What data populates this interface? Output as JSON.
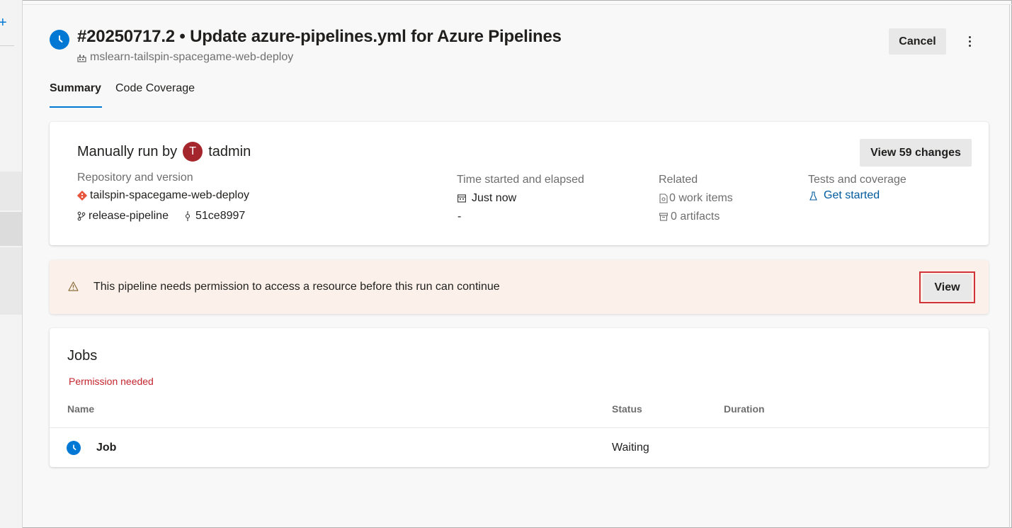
{
  "header": {
    "run_title": "#20250717.2 • Update azure-pipelines.yml for Azure Pipelines",
    "repo_name": "mslearn-tailspin-spacegame-web-deploy",
    "cancel_label": "Cancel",
    "more_icon": "more-vertical-icon",
    "status_icon": "clock-icon"
  },
  "tabs": [
    {
      "label": "Summary",
      "active": true
    },
    {
      "label": "Code Coverage",
      "active": false
    }
  ],
  "summary": {
    "manual_prefix": "Manually run by",
    "user_initial": "T",
    "user_name": "tadmin",
    "view_changes_label": "View 59 changes",
    "repo_label": "Repository and version",
    "repo_value": "tailspin-spacegame-web-deploy",
    "branch": "release-pipeline",
    "commit": "51ce8997",
    "time_label": "Time started and elapsed",
    "time_started": "Just now",
    "time_elapsed": "-",
    "related_label": "Related",
    "work_items": "0 work items",
    "artifacts": "0 artifacts",
    "tests_label": "Tests and coverage",
    "tests_link": "Get started"
  },
  "banner": {
    "message": "This pipeline needs permission to access a resource before this run can continue",
    "view_label": "View",
    "icon": "warning-icon"
  },
  "jobs": {
    "title": "Jobs",
    "status_note": "Permission needed",
    "columns": [
      "Name",
      "Status",
      "Duration"
    ],
    "rows": [
      {
        "name": "Job",
        "status": "Waiting",
        "duration": ""
      }
    ]
  },
  "colors": {
    "accent": "#0078d4",
    "avatar": "#a4262c",
    "warning_bg": "#fbf1ea",
    "error_text": "#c4262e",
    "highlight": "#d13438"
  }
}
